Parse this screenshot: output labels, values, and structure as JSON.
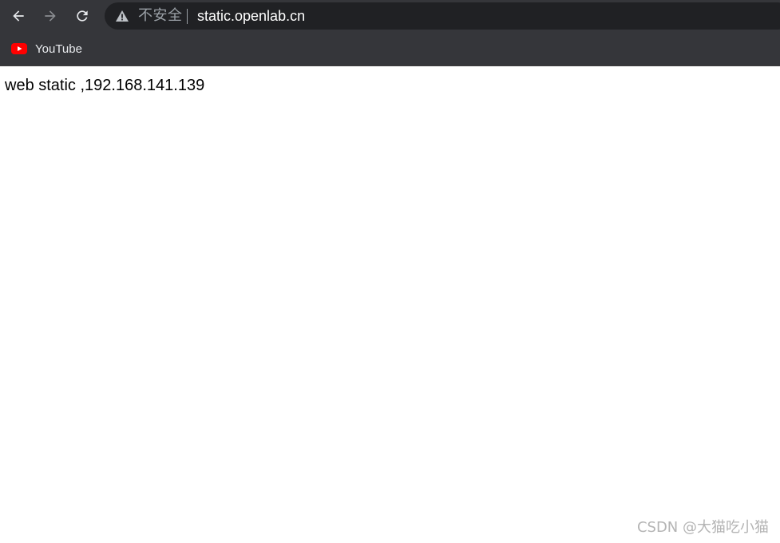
{
  "browser": {
    "nav": {
      "back_icon": "arrow-left-icon",
      "forward_icon": "arrow-right-icon",
      "reload_icon": "reload-icon"
    },
    "omnibox": {
      "security_icon": "warning-triangle-icon",
      "security_label": "不安全",
      "url": "static.openlab.cn"
    },
    "bookmarks": [
      {
        "label": "YouTube",
        "icon": "youtube-icon",
        "icon_color": "#ff0000"
      }
    ]
  },
  "page": {
    "text": "web static ,192.168.141.139"
  },
  "watermark": {
    "text": "CSDN @大猫吃小猫"
  },
  "colors": {
    "toolbar_bg": "#35363a",
    "omnibox_bg": "#202124",
    "page_bg": "#ffffff"
  }
}
